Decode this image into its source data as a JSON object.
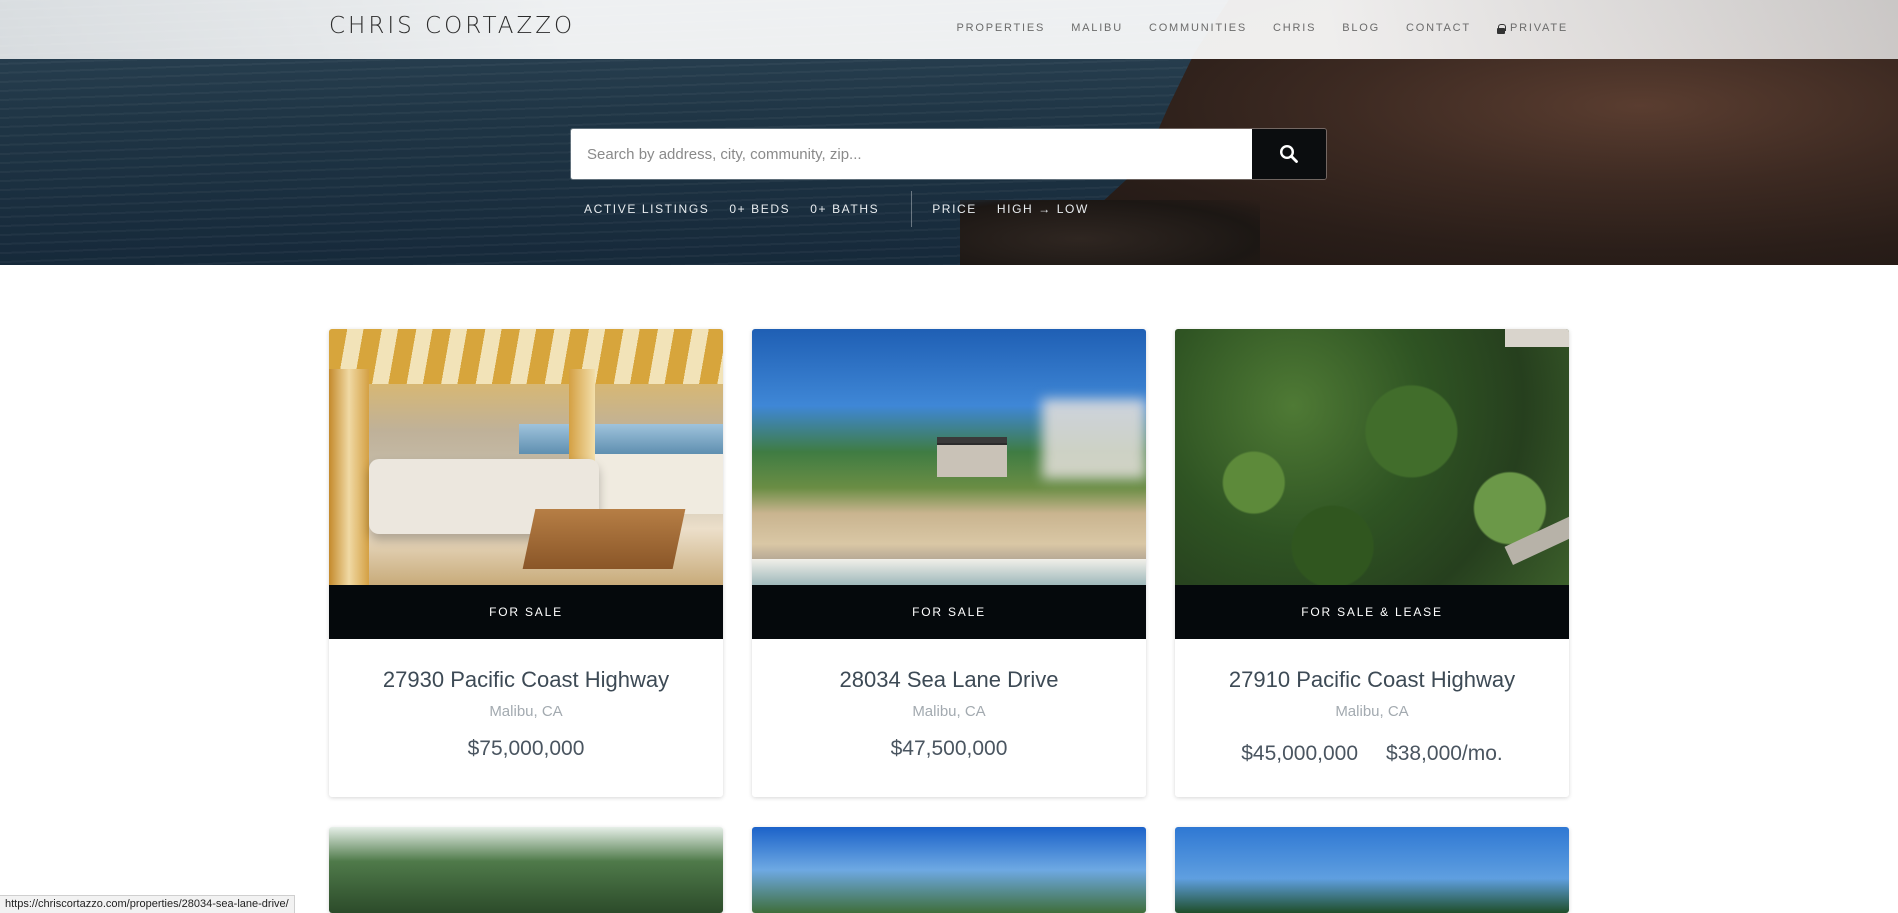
{
  "header": {
    "logo": "CHRIS CORTAZZO",
    "nav": [
      {
        "label": "PROPERTIES"
      },
      {
        "label": "MALIBU"
      },
      {
        "label": "COMMUNITIES"
      },
      {
        "label": "CHRIS"
      },
      {
        "label": "BLOG"
      },
      {
        "label": "CONTACT"
      },
      {
        "label": "PRIVATE",
        "icon": "lock-icon"
      }
    ]
  },
  "search": {
    "placeholder": "Search by address, city, community, zip...",
    "button_icon": "search-icon",
    "filters": {
      "status": "ACTIVE LISTINGS",
      "beds": "0+ BEDS",
      "baths": "0+ BATHS",
      "sort_by": "PRICE",
      "order": "HIGH → LOW"
    }
  },
  "listings": [
    {
      "status": "FOR SALE",
      "address": "27930 Pacific Coast Highway",
      "location": "Malibu, CA",
      "price": "$75,000,000"
    },
    {
      "status": "FOR SALE",
      "address": "28034 Sea Lane Drive",
      "location": "Malibu, CA",
      "price": "$47,500,000"
    },
    {
      "status": "FOR SALE & LEASE",
      "address": "27910 Pacific Coast Highway",
      "location": "Malibu, CA",
      "price": "$45,000,000",
      "lease_price": "$38,000/mo."
    }
  ],
  "browser": {
    "status_url": "https://chriscortazzo.com/properties/28034-sea-lane-drive/"
  },
  "colors": {
    "status_band": "#05090c",
    "search_button": "#0b0d0f",
    "title_text": "#3d4a55",
    "location_text": "#a3aab0"
  }
}
